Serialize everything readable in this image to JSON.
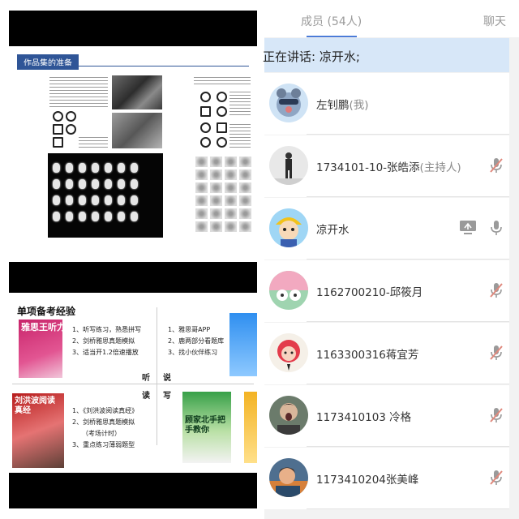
{
  "slides": {
    "slide1": {
      "title_tag": "作品集的准备"
    },
    "slide2": {
      "title": "单项备考经验",
      "book_listening": "雅思王听力",
      "book_reading": "刘洪波阅读真经",
      "book_gu": "顾家北手把手教你",
      "listening_tips": [
        "1、听写练习，熟悉拼写",
        "2、剑桥雅思真题模拟",
        "3、适当开1.2倍速播放"
      ],
      "speaking_tips": [
        "1、雅思哥APP",
        "2、鹿两部分看题库",
        "3、找小伙伴练习"
      ],
      "reading_tips": [
        "1、《刘洪波阅读真经》",
        "2、剑桥雅思真题模拟",
        "（考场计时）",
        "3、重点练习薄弱题型"
      ],
      "skills": {
        "listen": "听",
        "speak": "说",
        "read": "读",
        "write": "写"
      }
    }
  },
  "panel": {
    "tabs": {
      "members": "成员 (54人)",
      "chat": "聊天"
    },
    "speaking": "正在讲话: 凉开水;",
    "members": [
      {
        "name": "左钊鹏",
        "role": "(我)",
        "mic": "none",
        "share": false
      },
      {
        "name": "1734101-10-张皓添",
        "role": "(主持人)",
        "mic": "muted",
        "share": false
      },
      {
        "name": "凉开水",
        "role": "",
        "mic": "on",
        "share": true
      },
      {
        "name": "1162700210-邱筱月",
        "role": "",
        "mic": "muted",
        "share": false
      },
      {
        "name": "1163300316蒋宜芳",
        "role": "",
        "mic": "muted",
        "share": false
      },
      {
        "name": "1173410103 冷格",
        "role": "",
        "mic": "muted",
        "share": false
      },
      {
        "name": "1173410204张美峰",
        "role": "",
        "mic": "muted",
        "share": false
      }
    ]
  },
  "colors": {
    "accent": "#4a7bd8",
    "muted_mic": "#e0897d",
    "mic": "#9a9a9a",
    "speaking_bg": "#d7e7f8"
  }
}
